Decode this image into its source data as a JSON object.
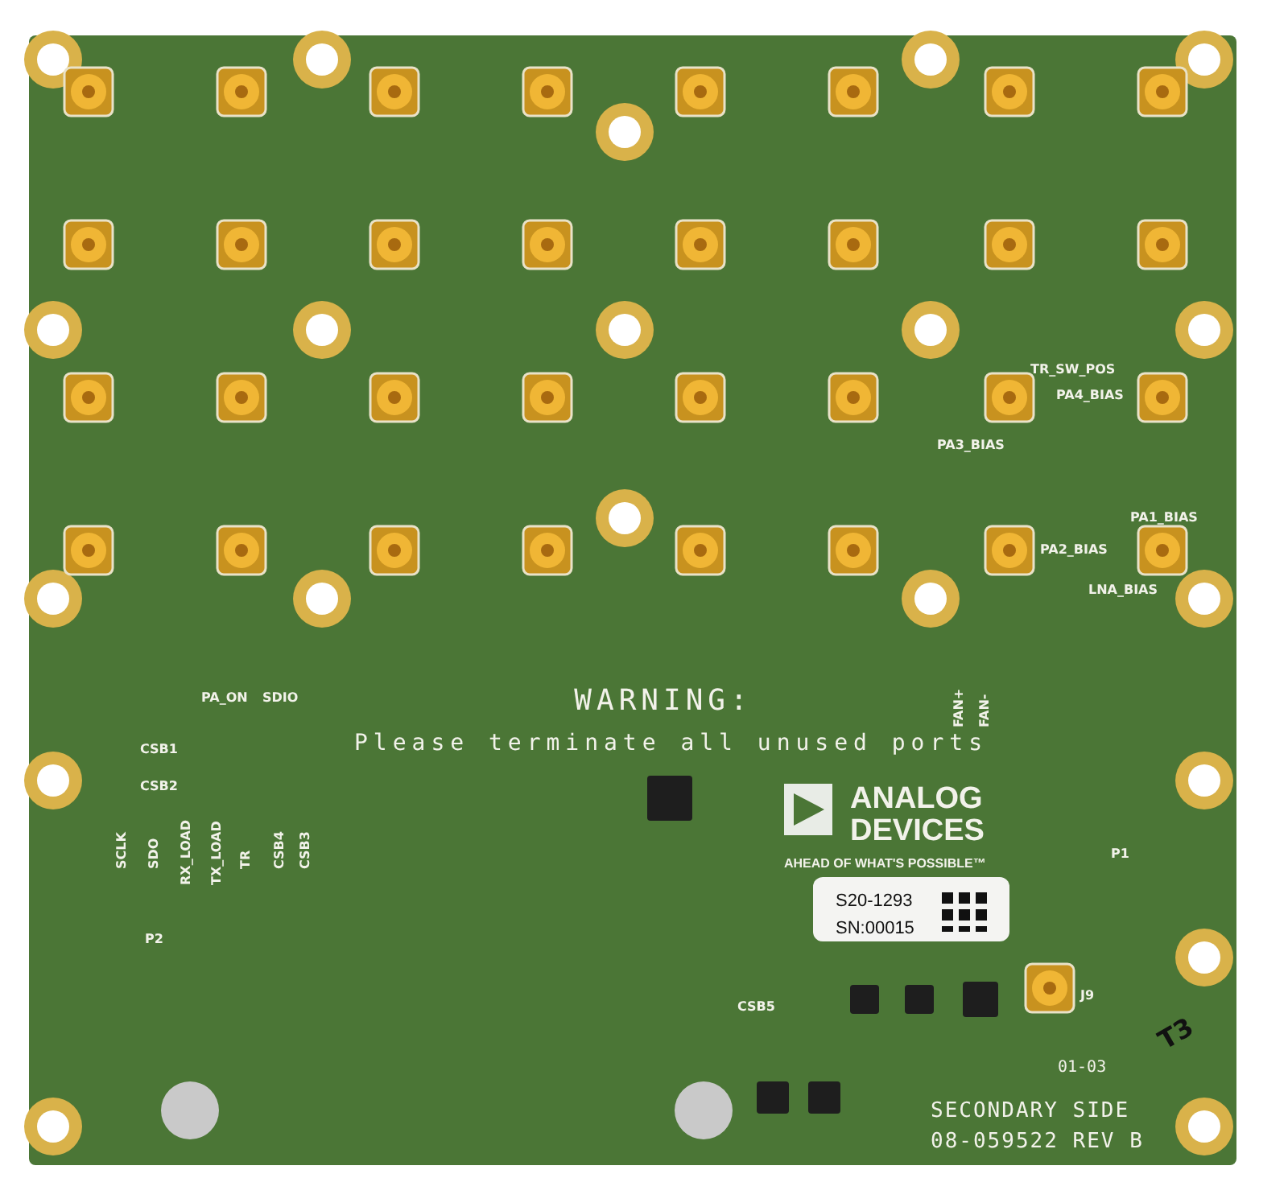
{
  "board": {
    "connectors": [
      {
        "kind": "sma"
      },
      {
        "kind": "sma"
      },
      {
        "kind": "sma"
      },
      {
        "kind": "sma"
      },
      {
        "kind": "sma"
      },
      {
        "kind": "sma"
      },
      {
        "kind": "sma"
      },
      {
        "kind": "sma"
      },
      {
        "kind": "sma"
      },
      {
        "kind": "sma"
      },
      {
        "kind": "sma"
      },
      {
        "kind": "sma"
      },
      {
        "kind": "sma"
      },
      {
        "kind": "sma"
      },
      {
        "kind": "sma"
      },
      {
        "kind": "sma"
      },
      {
        "kind": "sma"
      },
      {
        "kind": "sma"
      },
      {
        "kind": "sma"
      },
      {
        "kind": "sma"
      },
      {
        "kind": "sma"
      },
      {
        "kind": "sma"
      },
      {
        "kind": "sma"
      },
      {
        "kind": "sma"
      },
      {
        "kind": "sma"
      },
      {
        "kind": "sma"
      },
      {
        "kind": "sma"
      },
      {
        "kind": "sma"
      },
      {
        "kind": "sma"
      },
      {
        "kind": "sma"
      },
      {
        "kind": "sma"
      },
      {
        "kind": "sma"
      },
      {
        "kind": "sma"
      }
    ],
    "labels": [
      {
        "text": "TR_SW_POS",
        "kind": "silk"
      },
      {
        "text": "PA4_BIAS",
        "kind": "silk"
      },
      {
        "text": "PA3_BIAS",
        "kind": "silk"
      },
      {
        "text": "PA1_BIAS",
        "kind": "silk"
      },
      {
        "text": "PA2_BIAS",
        "kind": "silk"
      },
      {
        "text": "LNA_BIAS",
        "kind": "silk"
      },
      {
        "text": "FAN+",
        "kind": "silk-vertical"
      },
      {
        "text": "FAN-",
        "kind": "silk-vertical"
      },
      {
        "text": "PA_ON",
        "kind": "silk"
      },
      {
        "text": "SDIO",
        "kind": "silk"
      },
      {
        "text": "WARNING:",
        "kind": "warning-title"
      },
      {
        "text": "CSB1",
        "kind": "silk"
      },
      {
        "text": "Please terminate all unused ports",
        "kind": "warning-text"
      },
      {
        "text": "CSB2",
        "kind": "silk"
      },
      {
        "text": "ANALOG",
        "kind": "logo-line"
      },
      {
        "text": "DEVICES",
        "kind": "logo-line"
      },
      {
        "text": "SCLK",
        "kind": "silk-vertical"
      },
      {
        "text": "SDO",
        "kind": "silk-vertical"
      },
      {
        "text": "RX_LOAD",
        "kind": "silk-vertical"
      },
      {
        "text": "TX_LOAD",
        "kind": "silk-vertical"
      },
      {
        "text": "TR",
        "kind": "silk-vertical"
      },
      {
        "text": "CSB4",
        "kind": "silk-vertical"
      },
      {
        "text": "CSB3",
        "kind": "silk-vertical"
      },
      {
        "text": "AHEAD OF WHAT'S POSSIBLE™",
        "kind": "tagline"
      },
      {
        "text": "P1",
        "kind": "silk"
      },
      {
        "text": "S20-1293",
        "kind": "sticker-text"
      },
      {
        "text": "SN:00015",
        "kind": "sticker-text"
      },
      {
        "text": "P2",
        "kind": "silk"
      },
      {
        "text": "CSB5",
        "kind": "silk"
      },
      {
        "text": "J9",
        "kind": "silk"
      },
      {
        "text": "T3",
        "kind": "marker"
      },
      {
        "text": "01-03",
        "kind": "silk-large"
      },
      {
        "text": "SECONDARY SIDE",
        "kind": "board-title"
      },
      {
        "text": "08-059522 REV B",
        "kind": "board-title"
      }
    ]
  }
}
